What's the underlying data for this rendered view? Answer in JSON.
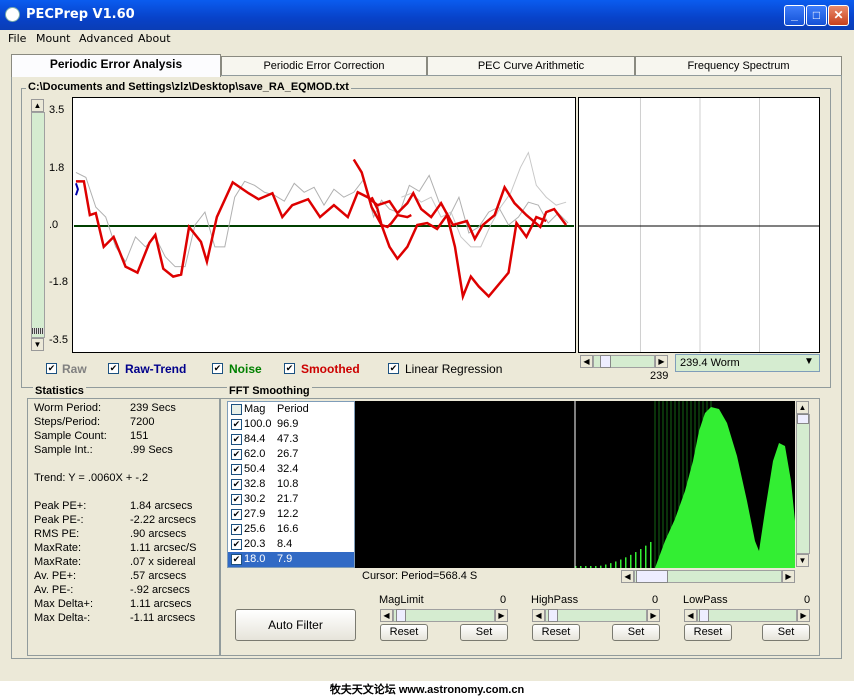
{
  "window": {
    "title": "PECPrep V1.60",
    "minimize": "_",
    "maximize": "□",
    "close": "✕"
  },
  "menu": [
    "File",
    "Mount",
    "Advanced",
    "About"
  ],
  "tabs": [
    "Periodic Error Analysis",
    "Periodic Error Correction",
    "PEC Curve Arithmetic",
    "Frequency Spectrum"
  ],
  "file_path": "C:\\Documents and Settings\\zlz\\Desktop\\save_RA_EQMOD.txt",
  "y_ticks": [
    "3.5",
    "1.8",
    ".0",
    "-1.8",
    "-3.5"
  ],
  "checkboxes": [
    {
      "label": "Raw",
      "checked": true,
      "color": "#808080"
    },
    {
      "label": "Raw-Trend",
      "checked": true,
      "color": "#00008B"
    },
    {
      "label": "Noise",
      "checked": true,
      "color": "#008000"
    },
    {
      "label": "Smoothed",
      "checked": true,
      "color": "#CC0000"
    },
    {
      "label": "Linear Regression",
      "checked": true,
      "color": "#000000"
    }
  ],
  "worm_value": "239",
  "worm_combo": "239.4 Worm",
  "statistics": {
    "title": "Statistics",
    "rows1": [
      {
        "k": "Worm Period:",
        "v": "239 Secs"
      },
      {
        "k": "Steps/Period:",
        "v": "7200"
      },
      {
        "k": "Sample Count:",
        "v": "151"
      },
      {
        "k": "Sample Int.:",
        "v": ".99 Secs"
      }
    ],
    "trend": "Trend: Y = .0060X + -.2",
    "rows2": [
      {
        "k": "Peak PE+:",
        "v": "1.84 arcsecs"
      },
      {
        "k": "Peak PE-:",
        "v": "-2.22 arcsecs"
      },
      {
        "k": "RMS PE:",
        "v": ".90 arcsecs"
      },
      {
        "k": "MaxRate:",
        "v": "1.11 arcsec/S"
      },
      {
        "k": "MaxRate:",
        "v": ".07 x sidereal"
      },
      {
        "k": "Av. PE+:",
        "v": ".57 arcsecs"
      },
      {
        "k": "Av. PE-:",
        "v": "-.92 arcsecs"
      },
      {
        "k": "Max Delta+:",
        "v": "1.11 arcsecs"
      },
      {
        "k": "Max Delta-:",
        "v": "-1.11 arcsecs"
      }
    ]
  },
  "fft": {
    "title": "FFT Smoothing",
    "header": {
      "mag": "Mag",
      "period": "Period"
    },
    "rows": [
      {
        "mag": "100.0",
        "period": "96.9"
      },
      {
        "mag": "84.4",
        "period": "47.3"
      },
      {
        "mag": "62.0",
        "period": "26.7"
      },
      {
        "mag": "50.4",
        "period": "32.4"
      },
      {
        "mag": "32.8",
        "period": "10.8"
      },
      {
        "mag": "30.2",
        "period": "21.7"
      },
      {
        "mag": "27.9",
        "period": "12.2"
      },
      {
        "mag": "25.6",
        "period": "16.6"
      },
      {
        "mag": "20.3",
        "period": "8.4"
      },
      {
        "mag": "18.0",
        "period": "7.9"
      }
    ],
    "cursor": "Cursor: Period=568.4 S",
    "auto_filter": "Auto Filter",
    "sliders": [
      {
        "label": "MagLimit",
        "value": "0"
      },
      {
        "label": "HighPass",
        "value": "0"
      },
      {
        "label": "LowPass",
        "value": "0"
      }
    ],
    "reset": "Reset",
    "set": "Set"
  },
  "footer": "牧夫天文论坛 www.astronomy.com.cn"
}
